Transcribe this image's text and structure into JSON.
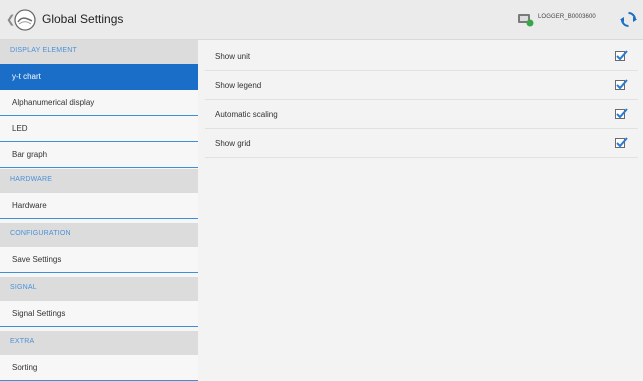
{
  "header": {
    "title": "Global Settings",
    "logger_label": "LOGGER_B0003600",
    "back_icon": "chevron-left-icon",
    "logo_icon": "app-logo-icon",
    "logger_icon": "logger-device-icon",
    "sync_icon": "sync-icon"
  },
  "sidebar": {
    "sections": [
      {
        "header": "DISPLAY ELEMENT",
        "items": [
          "y-t chart",
          "Alphanumerical display",
          "LED",
          "Bar graph"
        ]
      },
      {
        "header": "HARDWARE",
        "items": [
          "Hardware"
        ]
      },
      {
        "header": "CONFIGURATION",
        "items": [
          "Save Settings"
        ]
      },
      {
        "header": "SIGNAL",
        "items": [
          "Signal Settings"
        ]
      },
      {
        "header": "EXTRA",
        "items": [
          "Sorting"
        ]
      }
    ],
    "active_item": "y-t chart"
  },
  "options": [
    {
      "label": "Show unit",
      "checked": true
    },
    {
      "label": "Show legend",
      "checked": true
    },
    {
      "label": "Automatic scaling",
      "checked": true
    },
    {
      "label": "Show grid",
      "checked": true
    }
  ],
  "colors": {
    "accent": "#1a6ec7",
    "section_text": "#4a90d9",
    "section_bg": "#dcdcdc",
    "checkmark": "#2a7bd0"
  }
}
